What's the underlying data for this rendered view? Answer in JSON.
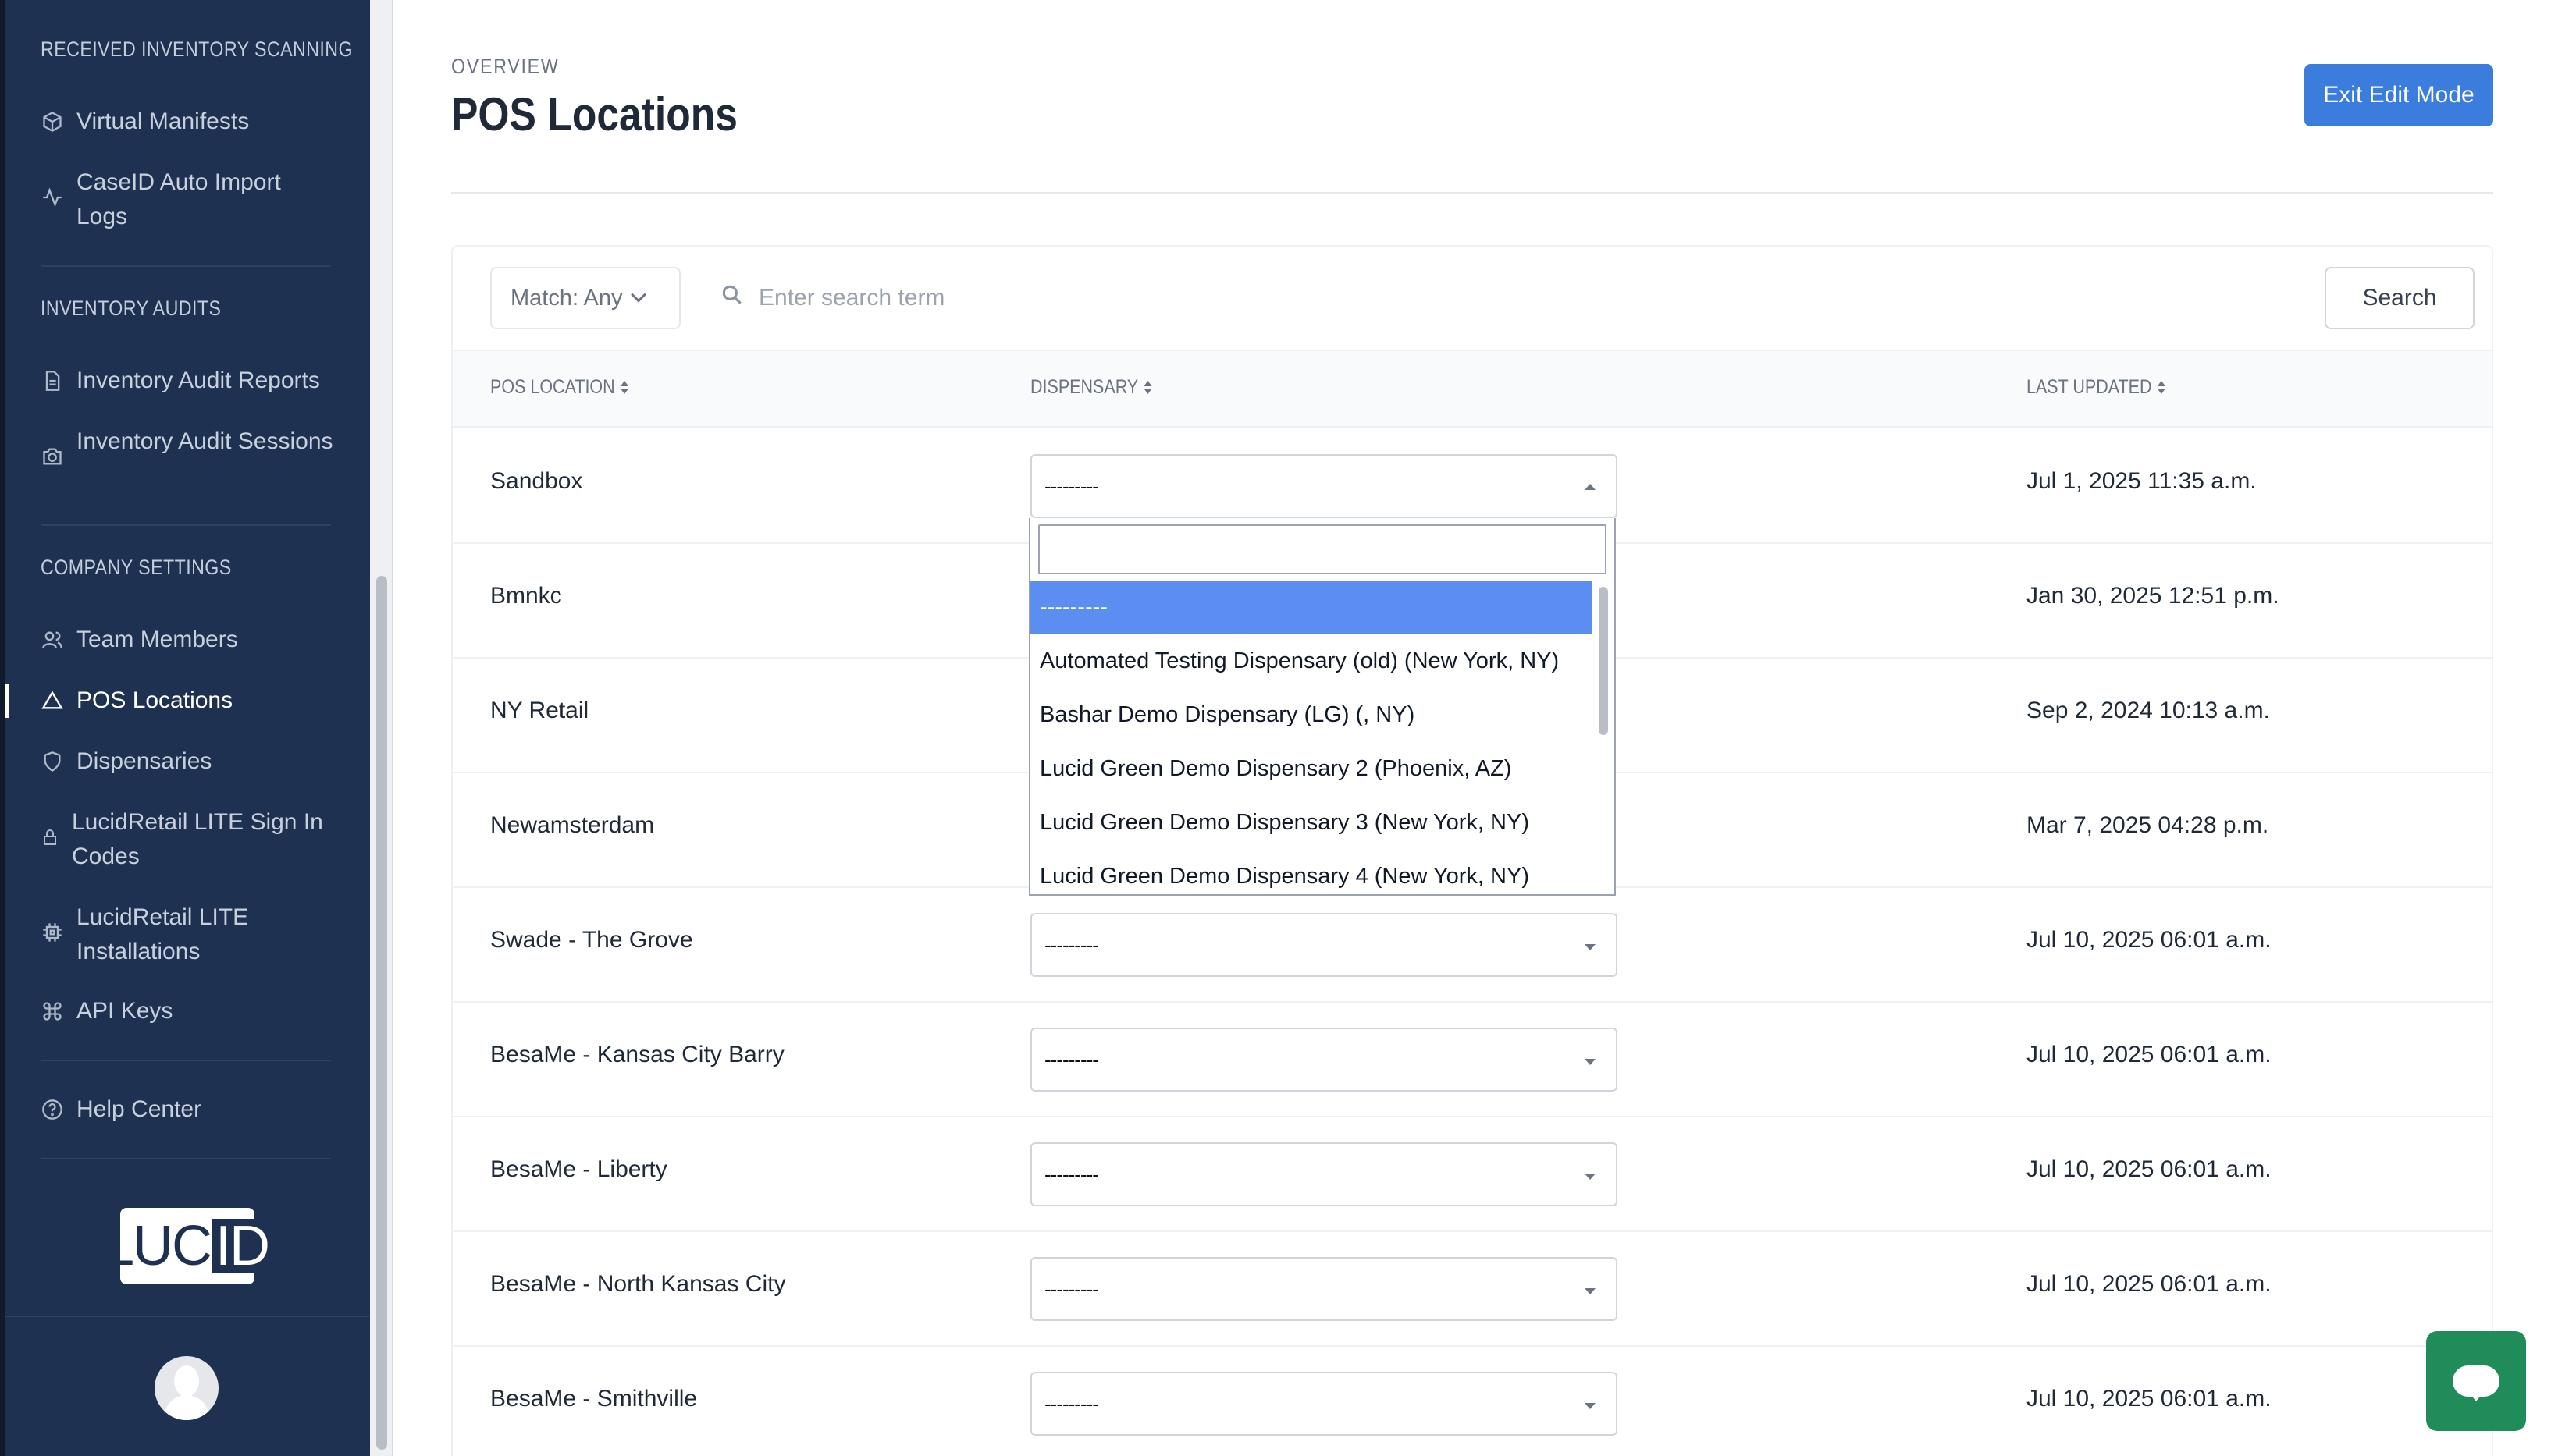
{
  "sidebar": {
    "sections": [
      {
        "heading": "RECEIVED INVENTORY SCANNING",
        "items": [
          {
            "label": "Virtual Manifests",
            "icon": "box-icon"
          },
          {
            "label": "CaseID Auto Import Logs",
            "icon": "activity-icon"
          }
        ]
      },
      {
        "heading": "INVENTORY AUDITS",
        "items": [
          {
            "label": "Inventory Audit Reports",
            "icon": "document-icon"
          },
          {
            "label": "Inventory Audit Sessions",
            "icon": "camera-icon"
          }
        ]
      },
      {
        "heading": "COMPANY SETTINGS",
        "items": [
          {
            "label": "Team Members",
            "icon": "users-icon"
          },
          {
            "label": "POS Locations",
            "icon": "triangle-icon",
            "active": true
          },
          {
            "label": "Dispensaries",
            "icon": "shield-icon"
          },
          {
            "label": "LucidRetail LITE Sign In Codes",
            "icon": "lock-icon"
          },
          {
            "label": "LucidRetail LITE Installations",
            "icon": "chip-icon"
          },
          {
            "label": "API Keys",
            "icon": "command-icon"
          }
        ]
      }
    ],
    "help": {
      "label": "Help Center",
      "icon": "help-circle-icon"
    },
    "logo": {
      "text": "LUC",
      "accent": "ID"
    }
  },
  "header": {
    "overline": "OVERVIEW",
    "title": "POS Locations",
    "exit_button": "Exit Edit Mode"
  },
  "toolbar": {
    "match_label": "Match: Any",
    "search_placeholder": "Enter search term",
    "search_button": "Search"
  },
  "table": {
    "columns": [
      "POS LOCATION",
      "DISPENSARY",
      "LAST UPDATED"
    ],
    "rows": [
      {
        "location": "Sandbox",
        "dispensary": "---------",
        "updated": "Jul 1, 2025 11:35 a.m."
      },
      {
        "location": "Bmnkc",
        "dispensary": "---------",
        "updated": "Jan 30, 2025 12:51 p.m."
      },
      {
        "location": "NY Retail",
        "dispensary": "---------",
        "updated": "Sep 2, 2024 10:13 a.m."
      },
      {
        "location": "Newamsterdam",
        "dispensary": "---------",
        "updated": "Mar 7, 2025 04:28 p.m."
      },
      {
        "location": "Swade - The Grove",
        "dispensary": "---------",
        "updated": "Jul 10, 2025 06:01 a.m."
      },
      {
        "location": "BesaMe - Kansas City Barry",
        "dispensary": "---------",
        "updated": "Jul 10, 2025 06:01 a.m."
      },
      {
        "location": "BesaMe - Liberty",
        "dispensary": "---------",
        "updated": "Jul 10, 2025 06:01 a.m."
      },
      {
        "location": "BesaMe - North Kansas City",
        "dispensary": "---------",
        "updated": "Jul 10, 2025 06:01 a.m."
      },
      {
        "location": "BesaMe - Smithville",
        "dispensary": "---------",
        "updated": "Jul 10, 2025 06:01 a.m."
      }
    ]
  },
  "dropdown": {
    "search_value": "",
    "options": [
      "---------",
      "Automated Testing Dispensary (old) (New York, NY)",
      "Bashar Demo Dispensary (LG) (, NY)",
      "Lucid Green Demo Dispensary 2 (Phoenix, AZ)",
      "Lucid Green Demo Dispensary 3 (New York, NY)",
      "Lucid Green Demo Dispensary 4 (New York, NY)"
    ],
    "selected_index": 0
  },
  "colors": {
    "sidebar_bg": "#1e3150",
    "primary": "#3b7ddd",
    "option_highlight": "#5b8ef0",
    "chat": "#1f8c5a"
  }
}
